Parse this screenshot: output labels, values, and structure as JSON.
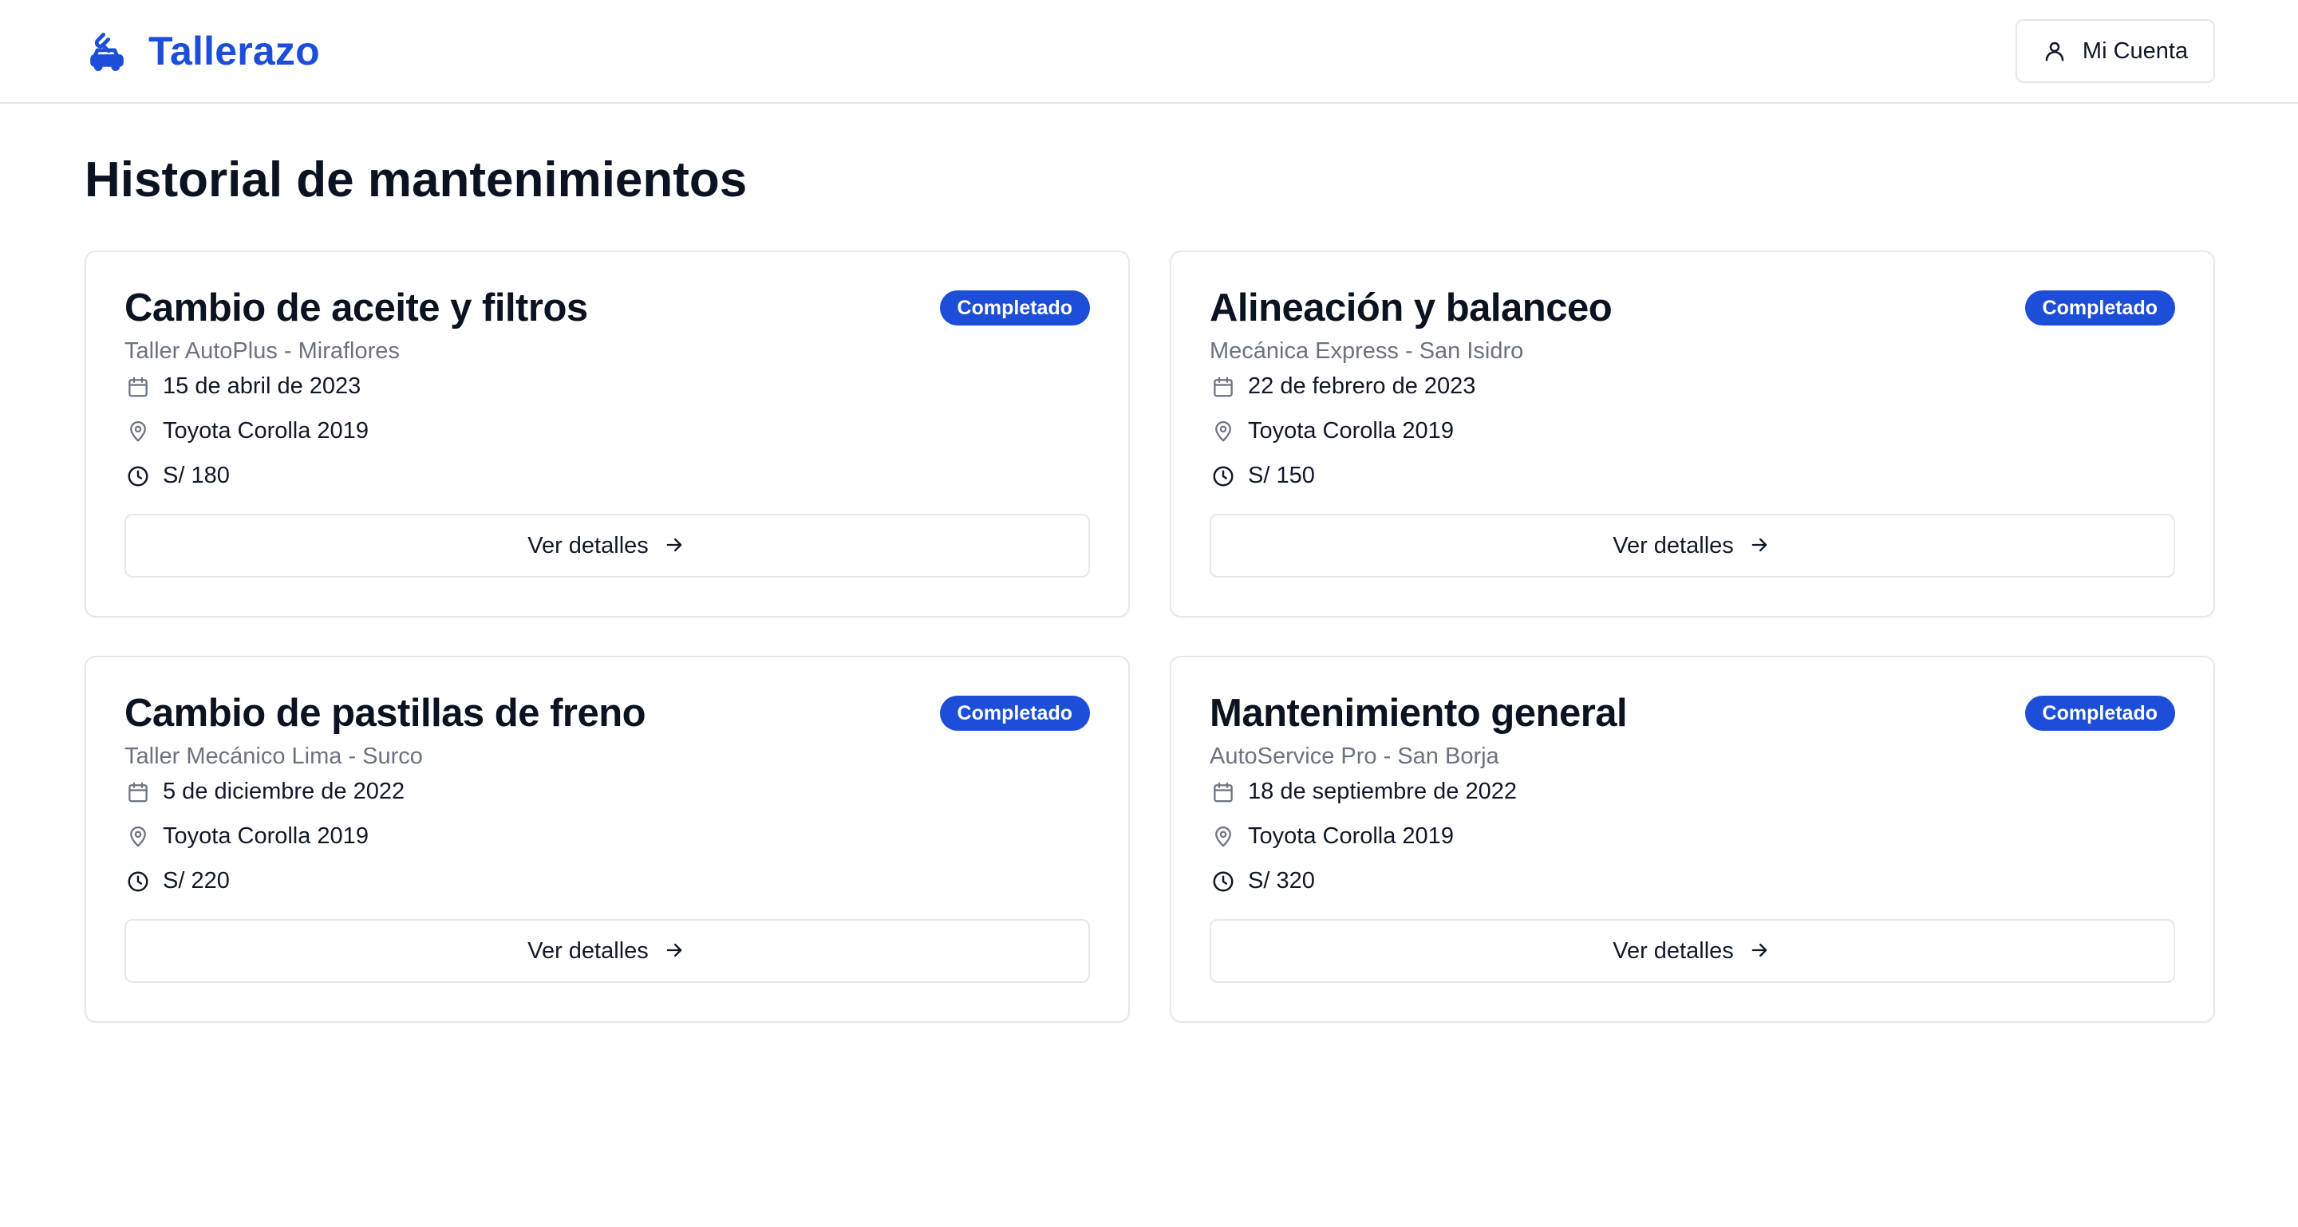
{
  "header": {
    "brand_name": "Tallerazo",
    "brand_icon": "car-wrench-icon",
    "account_label": "Mi Cuenta",
    "account_icon": "user-icon"
  },
  "page": {
    "title": "Historial de mantenimientos"
  },
  "colors": {
    "accent": "#1d4ed8",
    "muted_text": "#6b7280",
    "border": "#e5e7eb"
  },
  "cards": [
    {
      "title": "Cambio de aceite y filtros",
      "status": "Completado",
      "workshop": "Taller AutoPlus - Miraflores",
      "date": "15 de abril de 2023",
      "vehicle": "Toyota Corolla 2019",
      "cost": "S/ 180",
      "button_label": "Ver detalles"
    },
    {
      "title": "Alineación y balanceo",
      "status": "Completado",
      "workshop": "Mecánica Express - San Isidro",
      "date": "22 de febrero de 2023",
      "vehicle": "Toyota Corolla 2019",
      "cost": "S/ 150",
      "button_label": "Ver detalles"
    },
    {
      "title": "Cambio de pastillas de freno",
      "status": "Completado",
      "workshop": "Taller Mecánico Lima - Surco",
      "date": "5 de diciembre de 2022",
      "vehicle": "Toyota Corolla 2019",
      "cost": "S/ 220",
      "button_label": "Ver detalles"
    },
    {
      "title": "Mantenimiento general",
      "status": "Completado",
      "workshop": "AutoService Pro - San Borja",
      "date": "18 de septiembre de 2022",
      "vehicle": "Toyota Corolla 2019",
      "cost": "S/ 320",
      "button_label": "Ver detalles"
    }
  ],
  "icons": {
    "date": "calendar-icon",
    "vehicle": "map-pin-icon",
    "cost": "clock-icon",
    "button": "arrow-right-icon"
  }
}
